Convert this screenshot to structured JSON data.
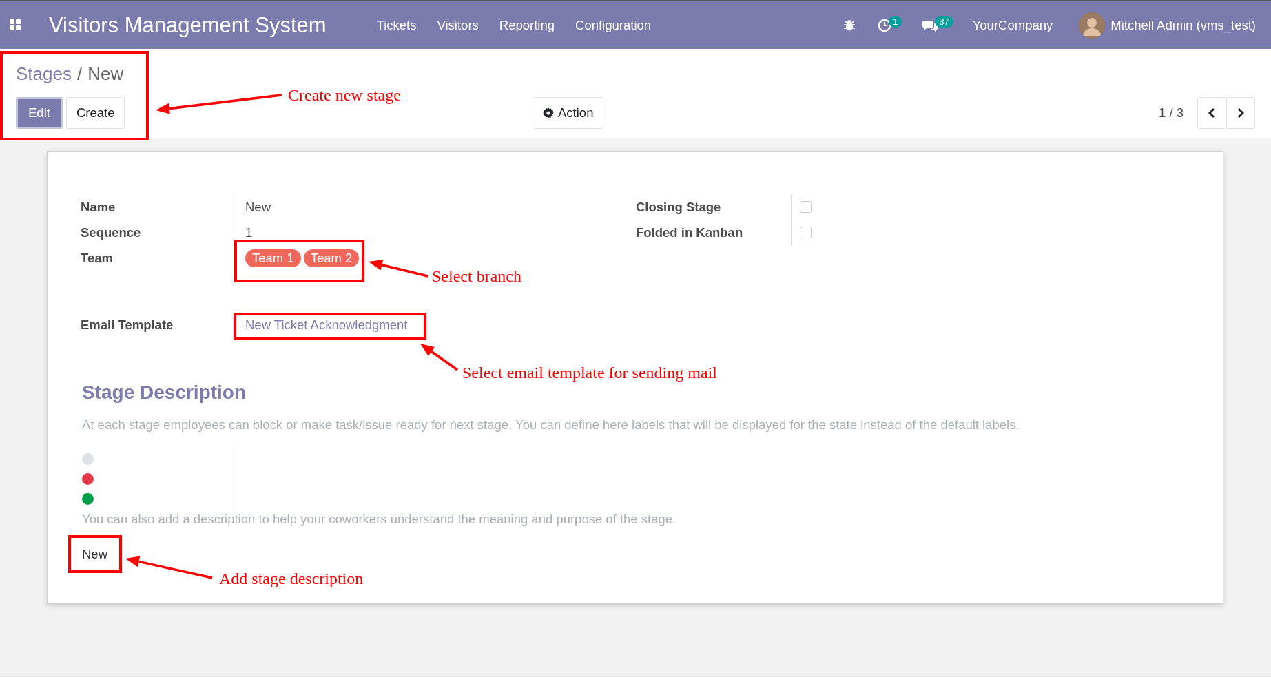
{
  "navbar": {
    "app_title": "Visitors Management System",
    "menu": [
      "Tickets",
      "Visitors",
      "Reporting",
      "Configuration"
    ],
    "activity_badge": "1",
    "messages_badge": "37",
    "company": "YourCompany",
    "user": "Mitchell Admin (vms_test)"
  },
  "breadcrumb": [
    "Stages",
    "New"
  ],
  "breadcrumb_separator": "/",
  "buttons": [
    {
      "label": "Edit",
      "kind": "primary"
    },
    {
      "label": "Create",
      "kind": "secondary"
    }
  ],
  "action_button": "Action",
  "pager": "1 / 3",
  "form": {
    "fields": [
      {
        "label": "Name",
        "value": "New"
      },
      {
        "label": "Sequence",
        "value": "1"
      }
    ],
    "team": {
      "label": "Team",
      "tags": [
        "Team 1",
        "Team 2"
      ]
    },
    "email_template": {
      "label": "Email Template",
      "value": "New Ticket Acknowledgment"
    },
    "checkboxes": [
      {
        "label": "Closing Stage",
        "checked": false
      },
      {
        "label": "Folded in Kanban",
        "checked": false
      }
    ],
    "section_title": "Stage Description",
    "help_text": "At each stage employees can block or make task/issue ready for next stage. You can define here labels that will be displayed for the state instead of the default labels.",
    "states": [
      {
        "color": "#dee2e6"
      },
      {
        "color": "#e63946"
      },
      {
        "color": "#00a04a"
      }
    ],
    "description_help": "You can also add a description to help your coworkers understand the meaning and purpose of the stage.",
    "description": "New"
  },
  "annotations": [
    {
      "text": "Create new stage"
    },
    {
      "text": "Select branch"
    },
    {
      "text": "Select email template for sending mail"
    },
    {
      "text": "Add stage description"
    }
  ]
}
